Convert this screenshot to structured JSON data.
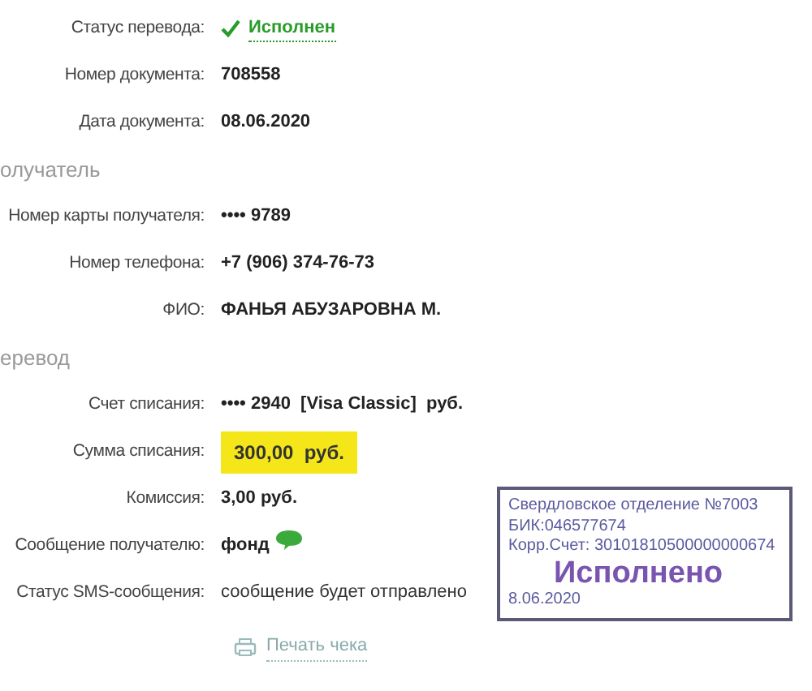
{
  "sections": [
    {
      "rows": [
        {
          "label": "Статус перевода:",
          "value": "Исполнен",
          "kind": "status"
        },
        {
          "label": "Номер документа:",
          "value": "708558",
          "kind": "bold"
        },
        {
          "label": "Дата документа:",
          "value": "08.06.2020",
          "kind": "bold"
        }
      ]
    },
    {
      "title": "олучатель",
      "rows": [
        {
          "label": "Номер карты получателя:",
          "value": "•••• 9789",
          "kind": "bold"
        },
        {
          "label": "Номер телефона:",
          "value": "+7 (906) 374-76-73",
          "kind": "bold"
        },
        {
          "label": "ФИО:",
          "value": "ФАНЬЯ АБУЗАРОВНА М.",
          "kind": "bold"
        }
      ]
    },
    {
      "title": "еревод",
      "rows": [
        {
          "label": "Счет списания:",
          "value": "•••• 2940  [Visa Classic]  руб.",
          "kind": "bold"
        },
        {
          "label": "Сумма списания:",
          "value": "300,00  руб.",
          "kind": "highlight"
        },
        {
          "label": "Комиссия:",
          "value": "3,00 руб.",
          "kind": "bold"
        },
        {
          "label": "Сообщение получателю:",
          "value": "фонд",
          "kind": "message"
        },
        {
          "label": "Статус SMS-сообщения:",
          "value": "сообщение будет отправлено",
          "kind": "plain"
        }
      ]
    }
  ],
  "print_link": "Печать чека",
  "stamp": {
    "lines": [
      "Свердловское отделение №7003",
      "БИК:046577674",
      "Корр.Счет: 30101810500000000674"
    ],
    "status": "Исполнено",
    "date": "8.06.2020"
  }
}
